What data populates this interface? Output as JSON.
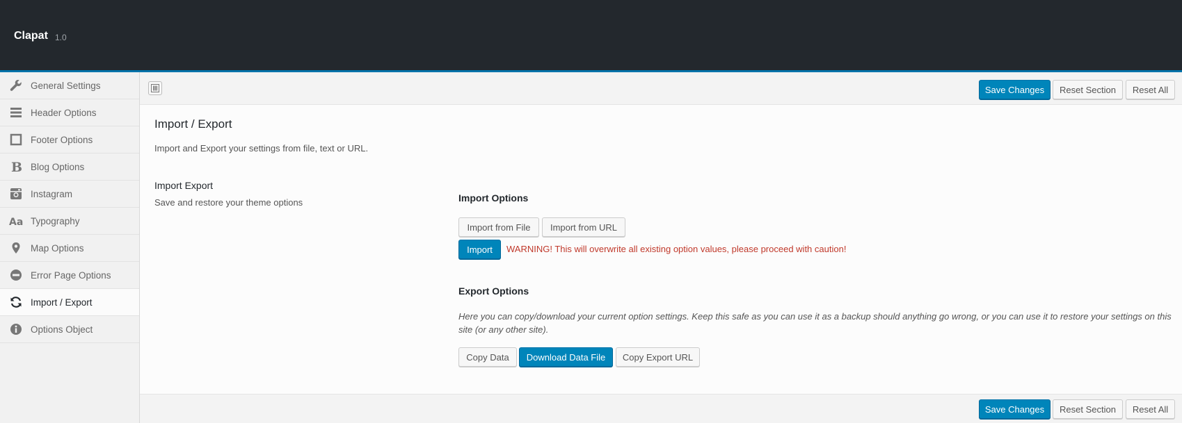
{
  "header": {
    "title": "Clapat",
    "version": "1.0"
  },
  "sidebar": {
    "items": [
      {
        "label": "General Settings",
        "icon": "wrench-icon"
      },
      {
        "label": "Header Options",
        "icon": "menu-lines-icon"
      },
      {
        "label": "Footer Options",
        "icon": "square-outline-icon"
      },
      {
        "label": "Blog Options",
        "icon": "bold-b-icon"
      },
      {
        "label": "Instagram",
        "icon": "instagram-icon"
      },
      {
        "label": "Typography",
        "icon": "font-aa-icon"
      },
      {
        "label": "Map Options",
        "icon": "map-marker-icon"
      },
      {
        "label": "Error Page Options",
        "icon": "minus-circle-icon"
      },
      {
        "label": "Import / Export",
        "icon": "refresh-icon",
        "active": true
      },
      {
        "label": "Options Object",
        "icon": "info-circle-icon"
      }
    ]
  },
  "toolbar": {
    "save_label": "Save Changes",
    "reset_section_label": "Reset Section",
    "reset_all_label": "Reset All"
  },
  "section": {
    "title": "Import / Export",
    "description": "Import and Export your settings from file, text or URL."
  },
  "field": {
    "title": "Import Export",
    "subtitle": "Save and restore your theme options"
  },
  "import": {
    "heading": "Import Options",
    "from_file_label": "Import from File",
    "from_url_label": "Import from URL",
    "import_label": "Import",
    "warning": "WARNING! This will overwrite all existing option values, please proceed with caution!"
  },
  "export": {
    "heading": "Export Options",
    "description": "Here you can copy/download your current option settings. Keep this safe as you can use it as a backup should anything go wrong, or you can use it to restore your settings on this site (or any other site).",
    "copy_label": "Copy Data",
    "download_label": "Download Data File",
    "copy_url_label": "Copy Export URL"
  },
  "colors": {
    "header_bg": "#23282d",
    "accent": "#0073aa",
    "primary_button": "#0085ba",
    "warning": "#c0392b"
  }
}
